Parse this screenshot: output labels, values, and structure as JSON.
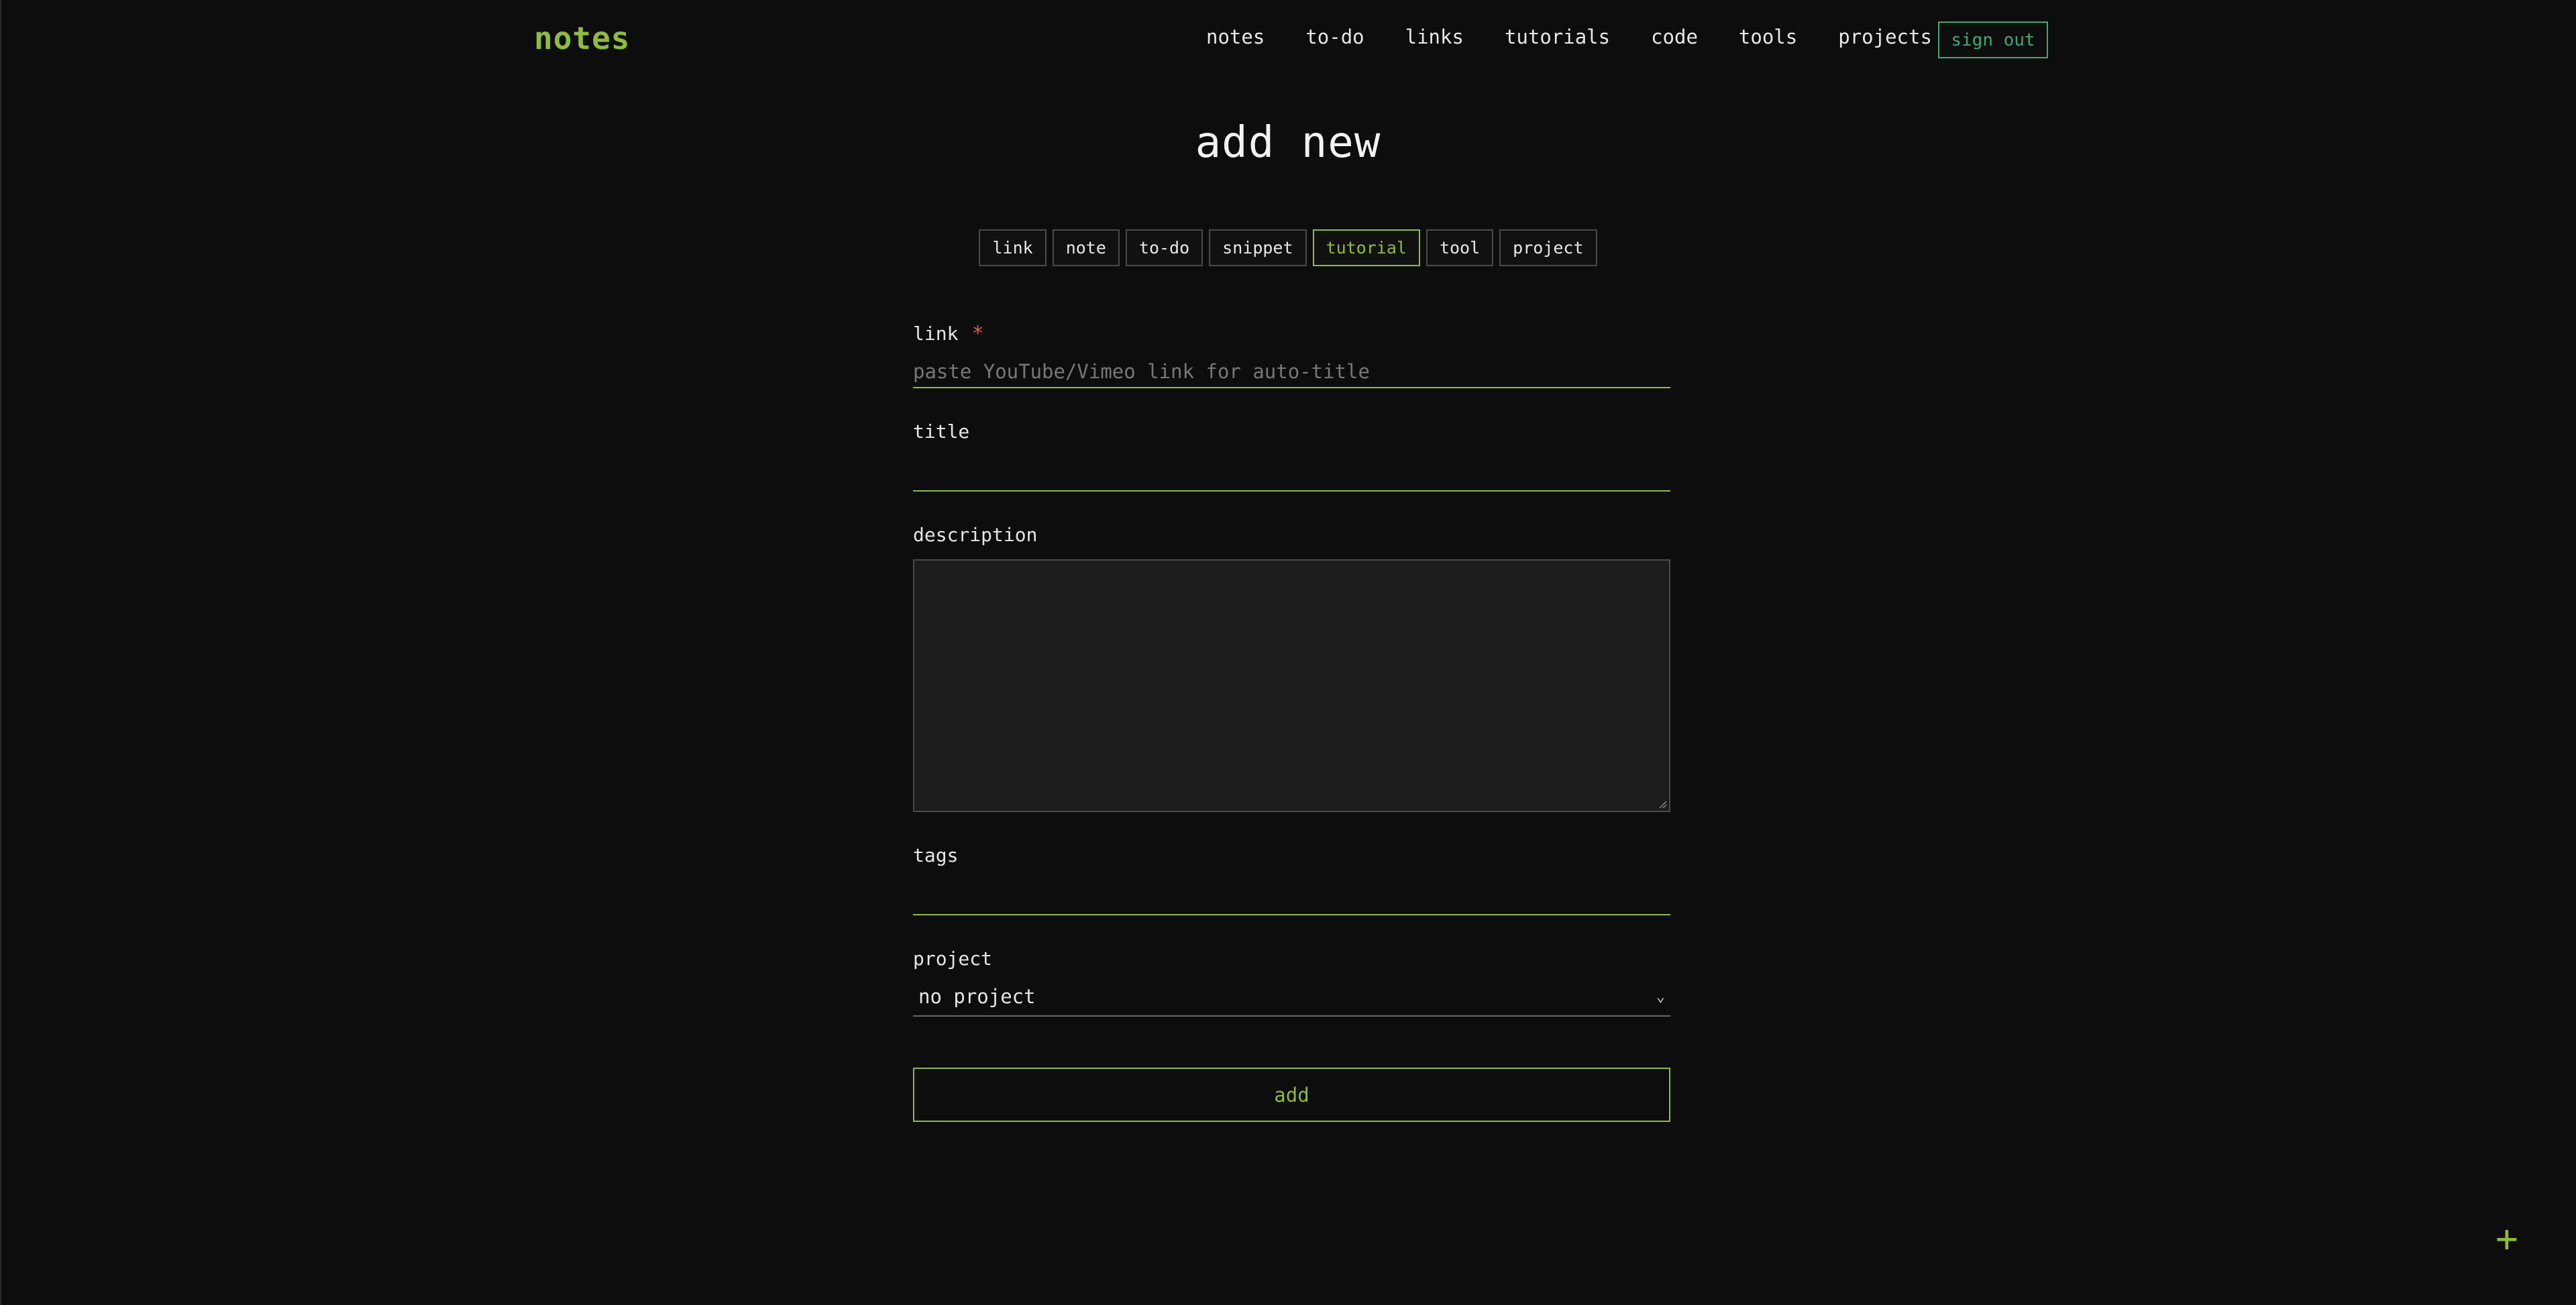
{
  "app": {
    "logo": "notes"
  },
  "nav": {
    "items": [
      "notes",
      "to-do",
      "links",
      "tutorials",
      "code",
      "tools",
      "projects"
    ],
    "sign_out": "sign out"
  },
  "page": {
    "title": "add new"
  },
  "types": {
    "items": [
      "link",
      "note",
      "to-do",
      "snippet",
      "tutorial",
      "tool",
      "project"
    ],
    "active": "tutorial"
  },
  "form": {
    "link": {
      "label": "link",
      "required": "*",
      "placeholder": "paste YouTube/Vimeo link for auto-title",
      "value": ""
    },
    "title": {
      "label": "title",
      "value": ""
    },
    "description": {
      "label": "description",
      "value": ""
    },
    "tags": {
      "label": "tags",
      "value": ""
    },
    "project": {
      "label": "project",
      "selected": "no project"
    },
    "submit": "add"
  },
  "fab": {
    "label": "+"
  },
  "colors": {
    "accent": "#8fbc3a",
    "signout": "#3aaa78",
    "required": "#e05555",
    "background": "#0d0d0d"
  }
}
